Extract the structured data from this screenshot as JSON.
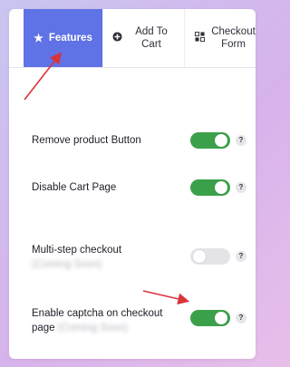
{
  "tabs": [
    {
      "label": "Features",
      "icon": "star-icon",
      "active": true
    },
    {
      "label": "Add To Cart",
      "icon": "plus-circle-icon",
      "active": false
    },
    {
      "label": "Checkout Form",
      "icon": "form-grid-icon",
      "active": false
    }
  ],
  "settings": [
    {
      "label": "Remove product Button",
      "blurred_note": "",
      "enabled": true,
      "help": "?"
    },
    {
      "label": "Disable Cart Page",
      "blurred_note": "",
      "enabled": true,
      "help": "?"
    },
    {
      "label": "Multi-step checkout",
      "blurred_note": "(Coming Soon)",
      "enabled": false,
      "help": "?"
    },
    {
      "label": "Enable captcha on checkout page",
      "blurred_note": "(Coming Soon)",
      "enabled": true,
      "help": "?"
    }
  ],
  "colors": {
    "accent": "#5f72e6",
    "toggle_on": "#3aa14a",
    "toggle_off": "#e4e4e8",
    "annotation_arrow": "#d9343a"
  }
}
